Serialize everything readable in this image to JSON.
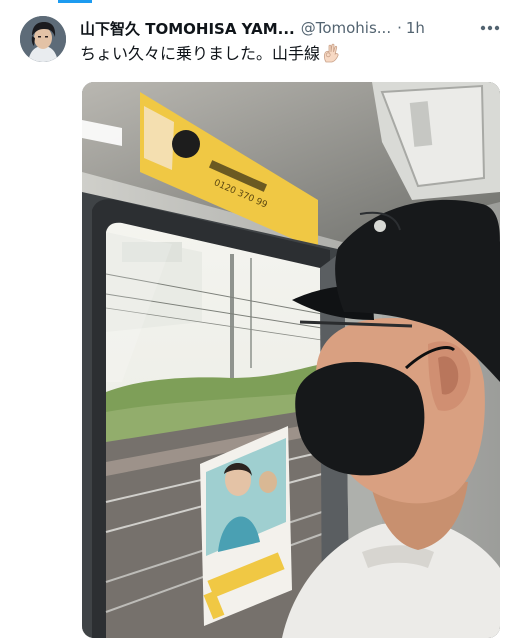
{
  "tweet": {
    "display_name": "山下智久 TOMOHISA YAM...",
    "handle": "@Tomohis...",
    "separator": "·",
    "time": "1h",
    "text": "ちょい久々に乗りました。山手線",
    "emoji_icon": "ok-hand-icon",
    "more_icon": "more-dots-icon"
  },
  "media": {
    "ad_phone": "0120 370 99"
  },
  "colors": {
    "accent": "#1d9bf0",
    "text": "#0f1419",
    "secondary": "#536471"
  }
}
